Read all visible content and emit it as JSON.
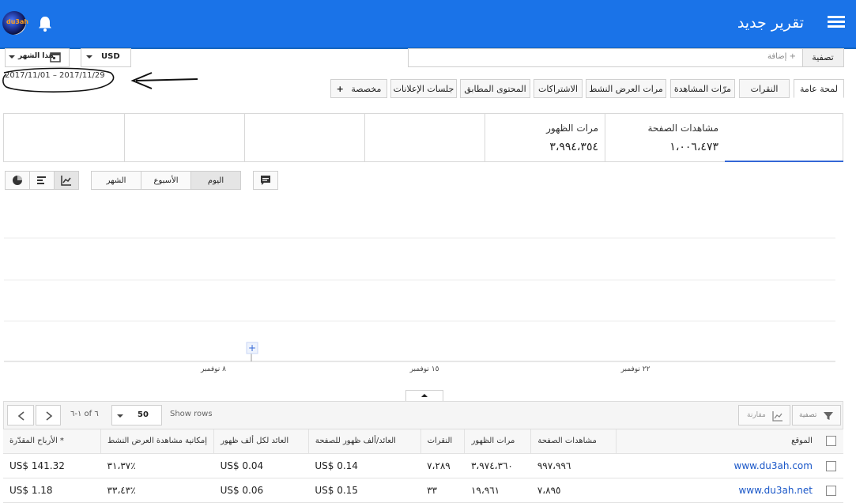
{
  "header": {
    "title": "تقرير جديد",
    "avatar_text": "du3ah"
  },
  "controls": {
    "filter_button": "تصفية",
    "add_placeholder": "+ إضافة",
    "currency": "USD",
    "period": "هذا الشهر",
    "date_range": "2017/11/01 – 2017/11/29"
  },
  "tabs": [
    {
      "label": "لمحة عامة",
      "active": true
    },
    {
      "label": "النقرات",
      "active": false
    },
    {
      "label": "مرّات المشاهدة",
      "active": false
    },
    {
      "label": "مرات العرض النشط",
      "active": false
    },
    {
      "label": "الاشتراكات",
      "active": false
    },
    {
      "label": "المحتوى المطابق",
      "active": false
    },
    {
      "label": "جلسات الإعلانات",
      "active": false
    },
    {
      "label": "مخصصة",
      "active": false
    }
  ],
  "metrics": [
    {
      "label": "مشاهدات الصفحة",
      "value": "١،٠٠٦،٤٧٣"
    },
    {
      "label": "مرات الظهور",
      "value": "٣،٩٩٤،٣٥٤"
    }
  ],
  "chart_toolbar": {
    "granularity": [
      {
        "label": "اليوم",
        "active": true
      },
      {
        "label": "الأسبوع",
        "active": false
      },
      {
        "label": "الشهر",
        "active": false
      }
    ],
    "view_icons": [
      "line-chart-icon",
      "bar-chart-icon",
      "pie-chart-icon"
    ],
    "comment_icon": "comment-icon"
  },
  "chart_data": {
    "type": "line",
    "x_tick_labels": [
      "٨ نوفمبر",
      "١٥ نوفمبر",
      "٢٢ نوفمبر"
    ],
    "series": [],
    "grid": true
  },
  "table_toolbar": {
    "filter_label": "تصفية",
    "compare_label": "مقارنة",
    "show_rows_label": "Show rows",
    "rows_value": "50",
    "pagination_text": "١-٦ of ٦"
  },
  "table": {
    "columns": [
      "الموقع",
      "مشاهدات الصفحة",
      "مرات الظهور",
      "النقرات",
      "العائد/ألف ظهور للصفحة",
      "العائد لكل ألف ظهور",
      "إمكانية مشاهدة العرض النشط",
      "* الأرباح المقدّرة"
    ],
    "rows": [
      [
        "www.du3ah.com",
        "٩٩٧،٩٩٦",
        "٣،٩٧٤،٣٦٠",
        "٧،٢٨٩",
        "US$ 0.14",
        "US$ 0.04",
        "٪٣١،٣٧",
        "US$ 141.32"
      ],
      [
        "www.du3ah.net",
        "٧،٨٩٥",
        "١٩،٩٦١",
        "٣٣",
        "US$ 0.15",
        "US$ 0.06",
        "٪٣٣،٤٣",
        "US$ 1.18"
      ]
    ]
  }
}
